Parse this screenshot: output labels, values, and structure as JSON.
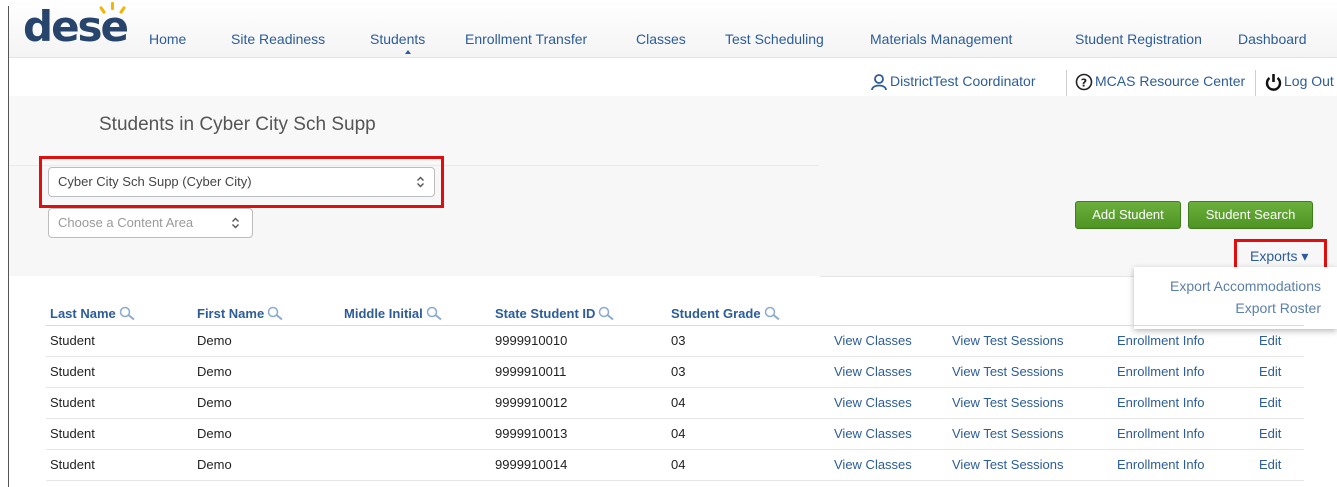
{
  "app": {
    "logo_text": "dese",
    "brand_color": "#26446c",
    "link_color": "#2c5c9a",
    "accent_green": "#5aa12f",
    "highlight_red": "#e10e0e"
  },
  "nav": {
    "items": [
      {
        "label": "Home"
      },
      {
        "label": "Site Readiness"
      },
      {
        "label": "Students"
      },
      {
        "label": "Enrollment Transfer"
      },
      {
        "label": "Classes"
      },
      {
        "label": "Test Scheduling"
      },
      {
        "label": "Materials Management"
      },
      {
        "label": "Student Registration"
      },
      {
        "label": "Dashboard"
      }
    ],
    "active": "Students"
  },
  "userbar": {
    "user_label": "DistrictTest Coordinator",
    "user_icon": "user-icon",
    "help_label": "MCAS Resource Center",
    "help_icon": "question-circle-icon",
    "logout_label": "Log Out",
    "logout_icon": "power-icon"
  },
  "page": {
    "title": "Students in Cyber City Sch Supp"
  },
  "filters": {
    "school_value": "Cyber City Sch Supp (Cyber City)",
    "content_area_placeholder": "Choose a Content Area"
  },
  "actions": {
    "add_student": "Add Student",
    "student_search": "Student Search",
    "exports": "Exports ▾",
    "exports_menu": [
      {
        "label": "Export Accommodations"
      },
      {
        "label": "Export Roster"
      }
    ]
  },
  "table": {
    "columns": [
      "Last Name",
      "First Name",
      "Middle Initial",
      "State Student ID",
      "Student Grade"
    ],
    "search_icon": "search-icon",
    "rows": [
      {
        "last": "Student",
        "first": "Demo",
        "middle": "",
        "ssid": "9999910010",
        "grade": "03"
      },
      {
        "last": "Student",
        "first": "Demo",
        "middle": "",
        "ssid": "9999910011",
        "grade": "03"
      },
      {
        "last": "Student",
        "first": "Demo",
        "middle": "",
        "ssid": "9999910012",
        "grade": "04"
      },
      {
        "last": "Student",
        "first": "Demo",
        "middle": "",
        "ssid": "9999910013",
        "grade": "04"
      },
      {
        "last": "Student",
        "first": "Demo",
        "middle": "",
        "ssid": "9999910014",
        "grade": "04"
      }
    ],
    "row_links": {
      "view_classes": "View Classes",
      "view_sessions": "View Test Sessions",
      "enrollment": "Enrollment Info",
      "edit": "Edit"
    }
  }
}
